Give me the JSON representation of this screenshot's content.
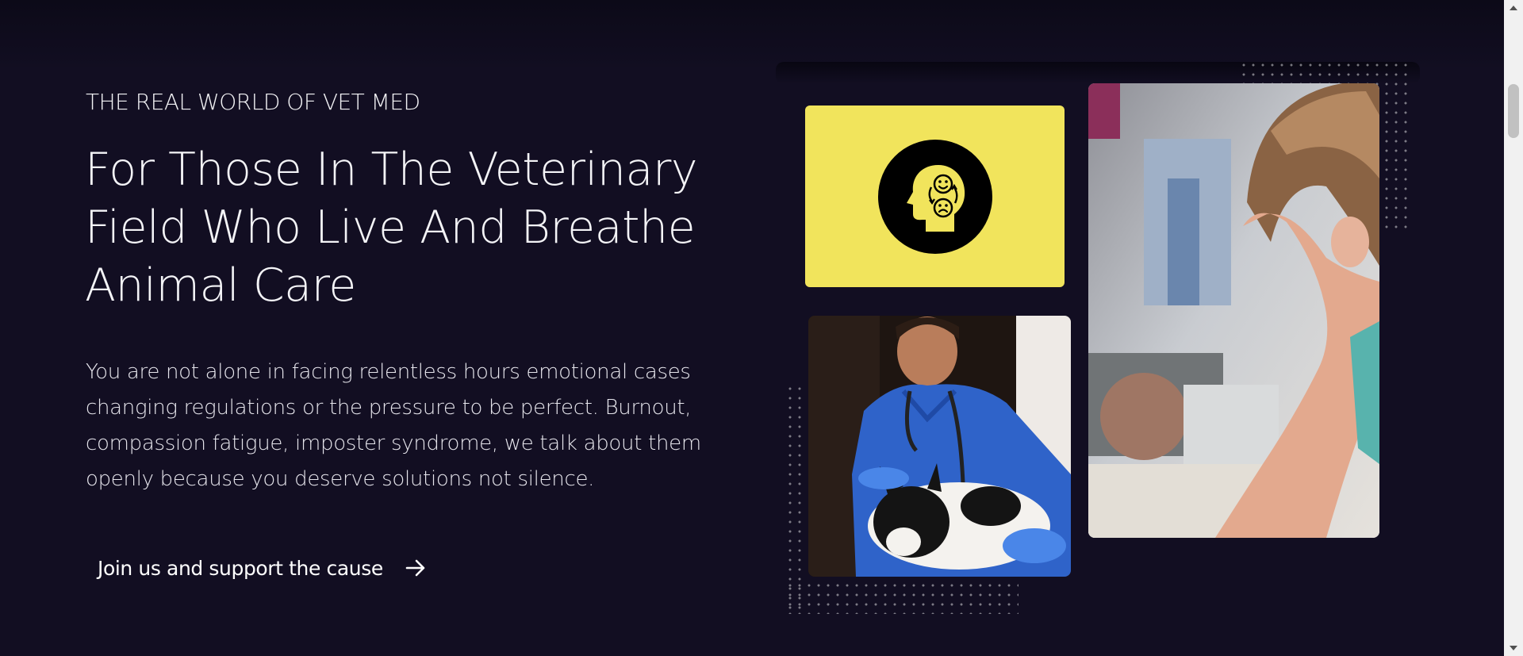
{
  "hero": {
    "eyebrow": "THE REAL WORLD OF VET MED",
    "headline_lines": [
      "For Those In The Veterinary",
      "Field Who Live And Breathe",
      "Animal Care"
    ],
    "body_lines": [
      "You are not alone in facing relentless hours emotional cases",
      "changing regulations or the pressure to be perfect. Burnout,",
      "compassion fatigue, imposter syndrome, we talk about them",
      "openly because you deserve solutions not silence."
    ],
    "cta_label": "Join us and support the cause",
    "cta_icon": "arrow-right-icon"
  },
  "collage": {
    "yellow_card_color": "#f1e45c",
    "mental_health_icon": "head-emotions-cycle-icon",
    "photo_vet": "veterinarian-with-french-bulldog-photo",
    "photo_woman": "stressed-woman-covering-face-photo"
  },
  "colors": {
    "background": "#120e22",
    "text": "#ffffff",
    "accent_yellow": "#f1e45c"
  }
}
